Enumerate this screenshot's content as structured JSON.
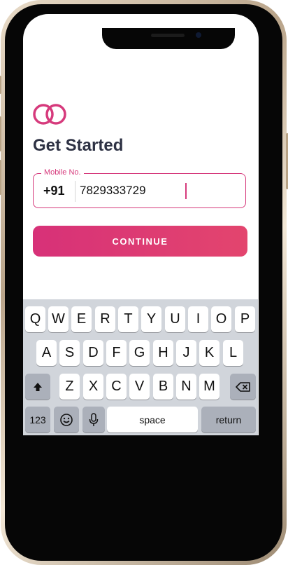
{
  "title": "Get Started",
  "mobile_field": {
    "label": "Mobile No.",
    "country_code": "+91",
    "value": "7829333729"
  },
  "continue_label": "CONTINUE",
  "keyboard": {
    "row1": [
      "Q",
      "W",
      "E",
      "R",
      "T",
      "Y",
      "U",
      "I",
      "O",
      "P"
    ],
    "row2": [
      "A",
      "S",
      "D",
      "F",
      "G",
      "H",
      "J",
      "K",
      "L"
    ],
    "row3": [
      "Z",
      "X",
      "C",
      "V",
      "B",
      "N",
      "M"
    ],
    "numbers_label": "123",
    "space_label": "space",
    "return_label": "return"
  },
  "colors": {
    "accent": "#d63a7c",
    "title": "#2d3143",
    "keyboard_bg": "#d1d5db"
  },
  "icons": [
    "rings-logo-icon",
    "shift-icon",
    "backspace-icon",
    "emoji-icon",
    "mic-icon"
  ]
}
